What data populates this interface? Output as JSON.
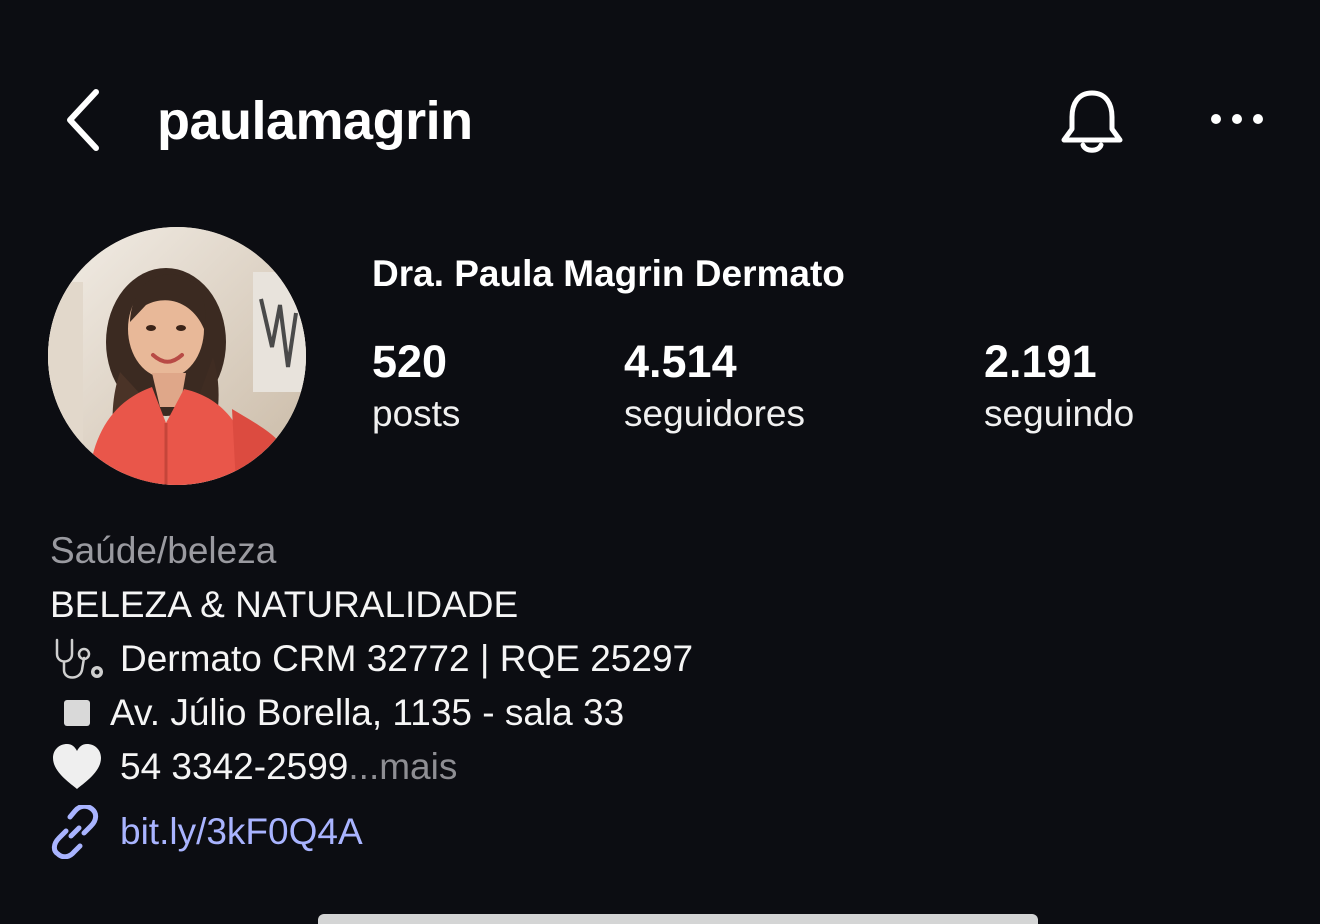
{
  "header": {
    "username": "paulamagrin",
    "back_icon": "chevron-left-icon",
    "bell_icon": "bell-icon",
    "more_icon": "more-horizontal-icon"
  },
  "profile": {
    "name": "Dra. Paula Magrin Dermato",
    "stats": [
      {
        "value": "520",
        "label": "posts"
      },
      {
        "value": "4.514",
        "label": "seguidores"
      },
      {
        "value": "2.191",
        "label": "seguindo"
      }
    ],
    "category": "Saúde/beleza",
    "bio": {
      "line1": "BELEZA & NATURALIDADE",
      "line2": "Dermato CRM 32772 | RQE 25297",
      "line3": "Av. Júlio Borella, 1135 - sala 33",
      "line4": "54 3342-2599",
      "ellipsis": "...",
      "more": " mais"
    },
    "link": "bit.ly/3kF0Q4A"
  },
  "colors": {
    "background": "#0c0d12",
    "text": "#f5f5f5",
    "muted": "#8e8e93",
    "link": "#a9b4ff"
  }
}
